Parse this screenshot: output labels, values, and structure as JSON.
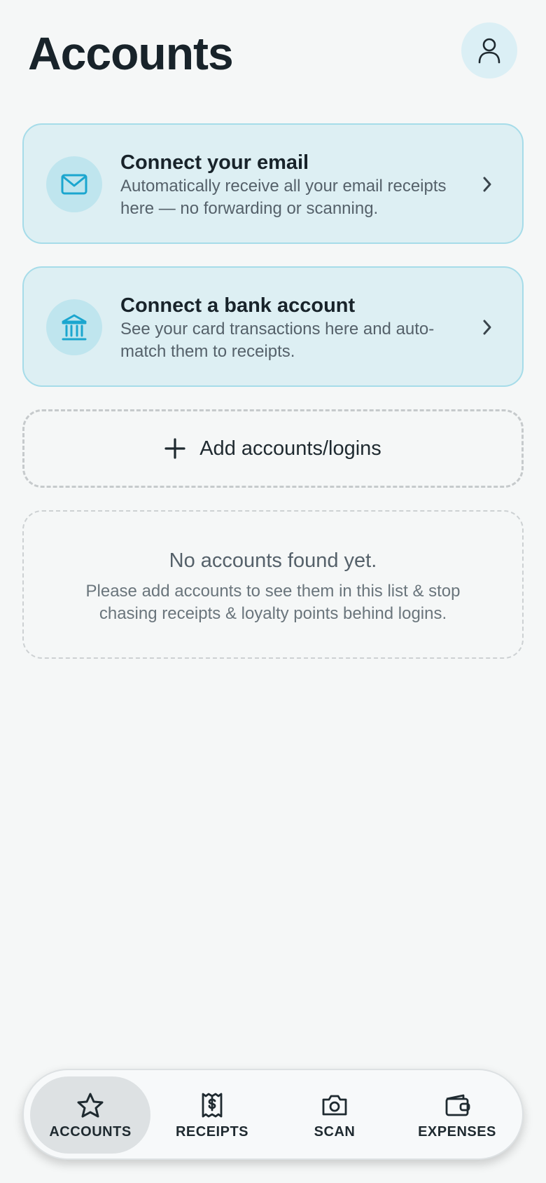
{
  "header": {
    "title": "Accounts",
    "profile_icon": "person-icon"
  },
  "cards": [
    {
      "title": "Connect your email",
      "description": "Automatically receive all your email receipts here — no forwarding or scanning.",
      "icon": "envelope-icon"
    },
    {
      "title": "Connect a bank account",
      "description": "See your card transactions here and auto-match them to receipts.",
      "icon": "bank-icon"
    }
  ],
  "add_button": {
    "label": "Add accounts/logins",
    "icon": "plus-icon"
  },
  "empty_state": {
    "title": "No accounts found yet.",
    "description": "Please add accounts to see them in this list & stop chasing receipts & loyalty points behind logins."
  },
  "nav": {
    "items": [
      {
        "label": "ACCOUNTS",
        "icon": "star-icon",
        "active": true
      },
      {
        "label": "RECEIPTS",
        "icon": "receipt-dollar-icon",
        "active": false
      },
      {
        "label": "SCAN",
        "icon": "camera-icon",
        "active": false
      },
      {
        "label": "EXPENSES",
        "icon": "wallet-icon",
        "active": false
      }
    ]
  },
  "colors": {
    "background": "#f5f7f7",
    "card_bg": "#ddeff3",
    "card_border": "#a6dce9",
    "accent": "#1ba6cf",
    "text_primary": "#18232a",
    "text_secondary": "#55616a"
  }
}
